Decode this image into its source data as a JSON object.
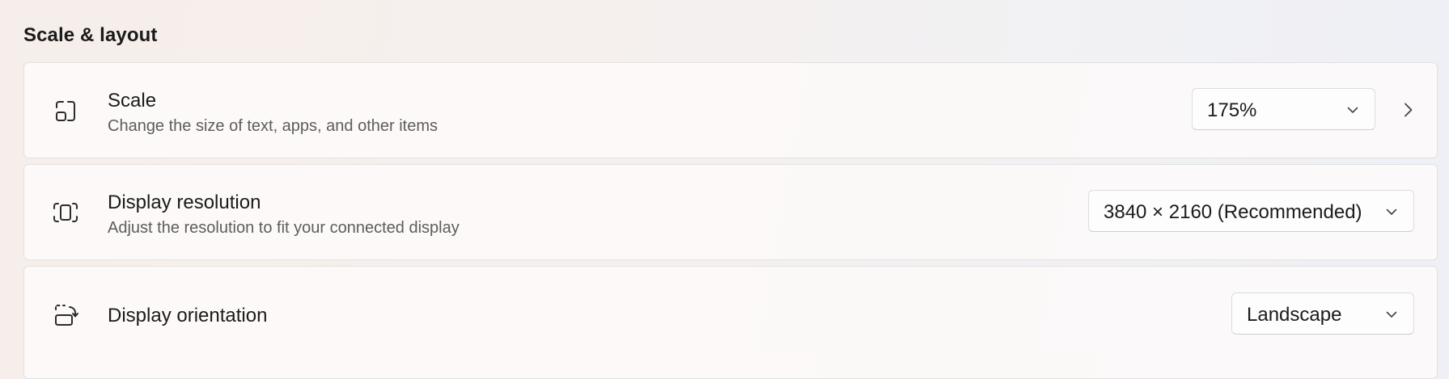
{
  "section": {
    "title": "Scale & layout"
  },
  "settings": {
    "scale": {
      "icon": "scale-icon",
      "title": "Scale",
      "description": "Change the size of text, apps, and other items",
      "selected_value": "175%",
      "has_navigation_chevron": true
    },
    "resolution": {
      "icon": "display-resolution-icon",
      "title": "Display resolution",
      "description": "Adjust the resolution to fit your connected display",
      "selected_value": "3840 × 2160 (Recommended)"
    },
    "orientation": {
      "icon": "display-orientation-icon",
      "title": "Display orientation",
      "selected_value": "Landscape"
    }
  },
  "colors": {
    "text_primary": "#1b1b1b",
    "text_secondary": "#5d5d5d",
    "card_background": "#fcfaf9",
    "card_border": "#e4e1df"
  }
}
